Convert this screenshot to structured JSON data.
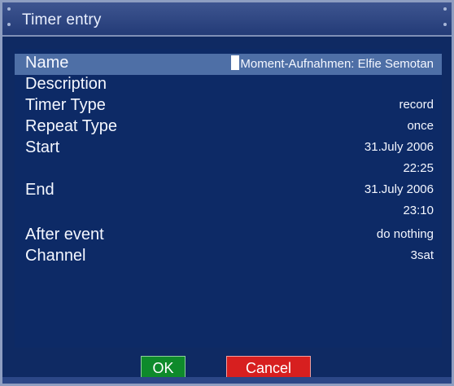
{
  "window": {
    "title": "Timer entry"
  },
  "form": {
    "name": {
      "label": "Name",
      "value_first_char": "M",
      "value_rest": "oment-Aufnahmen: Elfie Semotan"
    },
    "description": {
      "label": "Description",
      "value": ""
    },
    "timer_type": {
      "label": "Timer Type",
      "value": "record"
    },
    "repeat_type": {
      "label": "Repeat Type",
      "value": "once"
    },
    "start": {
      "label": "Start",
      "date": "31.July 2006",
      "time": "22:25"
    },
    "end": {
      "label": "End",
      "date": "31.July 2006",
      "time": "23:10"
    },
    "after_event": {
      "label": "After event",
      "value": "do nothing"
    },
    "channel": {
      "label": "Channel",
      "value": "3sat"
    }
  },
  "buttons": {
    "ok": "OK",
    "cancel": "Cancel"
  },
  "colors": {
    "window_bg": "#0f2a63",
    "selected_row": "#4e6fa6",
    "ok_button": "#0e8a2b",
    "cancel_button": "#d71f1f"
  }
}
